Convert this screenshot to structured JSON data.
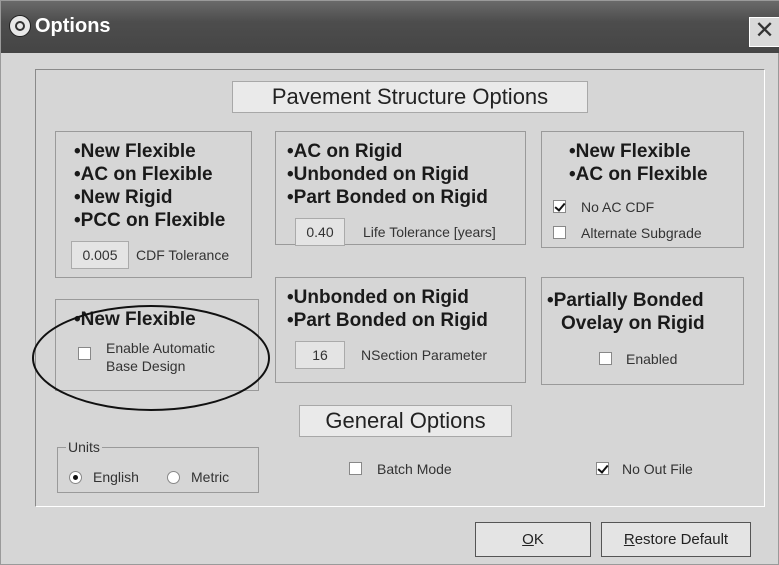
{
  "window": {
    "title": "Options",
    "close_glyph": "✕",
    "icon": "options-gear-icon"
  },
  "sections": {
    "pavement_title": "Pavement Structure Options",
    "general_title": "General Options"
  },
  "groups": {
    "g1": {
      "items": [
        "•New Flexible",
        "•AC on Flexible",
        "•New Rigid",
        "•PCC on Flexible"
      ],
      "field_value": "0.005",
      "field_label": "CDF Tolerance"
    },
    "g2": {
      "items": [
        "•AC on Rigid",
        "•Unbonded on Rigid",
        "•Part Bonded on Rigid"
      ],
      "field_value": "0.40",
      "field_label": "Life Tolerance [years]"
    },
    "g3": {
      "items": [
        "•New Flexible",
        "•AC on Flexible"
      ],
      "check1": {
        "label": "No AC CDF",
        "checked": true
      },
      "check2": {
        "label": "Alternate Subgrade",
        "checked": false
      }
    },
    "g4": {
      "items": [
        "•New Flexible"
      ],
      "check": {
        "line1": "Enable Automatic",
        "line2": "Base Design",
        "checked": false
      }
    },
    "g5": {
      "items": [
        "•Unbonded on Rigid",
        "•Part Bonded on Rigid"
      ],
      "field_value": "16",
      "field_label": "NSection Parameter"
    },
    "g6": {
      "items": [
        "•Partially Bonded",
        "Ovelay on Rigid"
      ],
      "check": {
        "label": "Enabled",
        "checked": false
      }
    }
  },
  "general": {
    "units_legend": "Units",
    "radio_english": {
      "label": "English",
      "checked": true
    },
    "radio_metric": {
      "label": "Metric",
      "checked": false
    },
    "batch_mode": {
      "label": "Batch Mode",
      "checked": false
    },
    "no_out_file": {
      "label": "No Out File",
      "checked": true
    }
  },
  "buttons": {
    "ok": {
      "mnemonic": "O",
      "rest": "K"
    },
    "restore": {
      "mnemonic": "R",
      "rest": "estore Default"
    }
  }
}
